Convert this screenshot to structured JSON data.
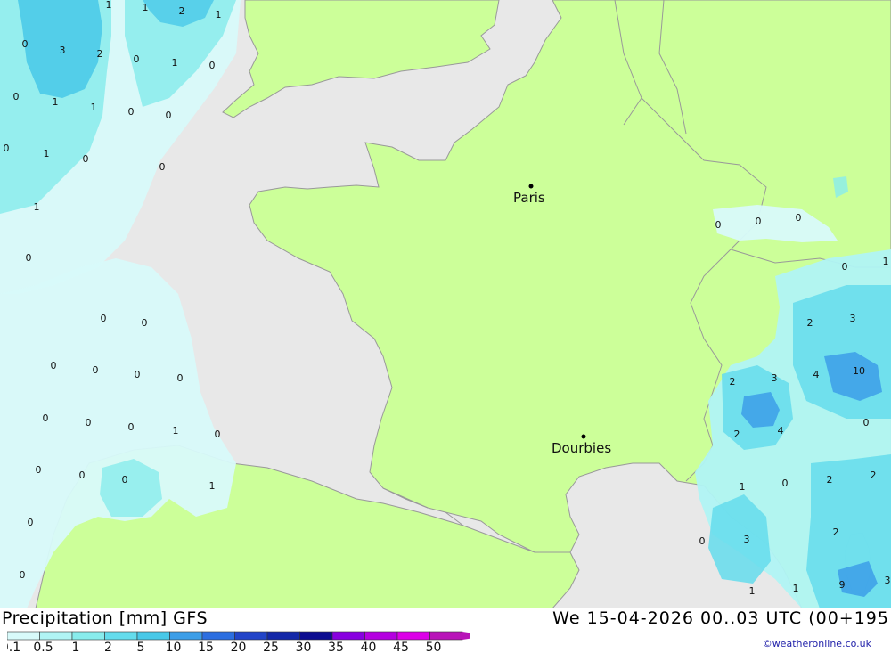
{
  "title": {
    "left": "Precipitation [mm] GFS",
    "right": "We 15-04-2026 00..03 UTC (00+195"
  },
  "credit": "©weatheronline.co.uk",
  "colors": {
    "sea": "#e8e8e8",
    "land": "#ccff99",
    "border": "#999999"
  },
  "legend": {
    "labels": [
      "0.1",
      "0.5",
      "1",
      "2",
      "5",
      "10",
      "15",
      "20",
      "25",
      "30",
      "35",
      "40",
      "45",
      "50"
    ],
    "colors": [
      "#d8fafa",
      "#b0f4f4",
      "#88ecec",
      "#64dcec",
      "#48c8e8",
      "#3c9ee8",
      "#2c6ee0",
      "#2244c8",
      "#1428a8",
      "#0c0c90",
      "#8800e0",
      "#b400e0",
      "#dc00e8",
      "#b814b8"
    ]
  },
  "cities": [
    {
      "name": "Paris"
    },
    {
      "name": "Dourbies"
    }
  ],
  "values": [
    "1",
    "2",
    "1",
    "1",
    "3",
    "2",
    "0",
    "1",
    "0",
    "0",
    "1",
    "1",
    "0",
    "0",
    "0",
    "1",
    "0",
    "0",
    "1",
    "0",
    "0",
    "0",
    "0",
    "0",
    "0",
    "0",
    "0",
    "0",
    "0",
    "1",
    "0",
    "0",
    "0",
    "0",
    "1",
    "0",
    "0",
    "0",
    "0",
    "0",
    "0",
    "0",
    "1",
    "2",
    "3",
    "4",
    "10",
    "2",
    "3",
    "2",
    "4",
    "0",
    "1",
    "0",
    "2",
    "2",
    "3",
    "2",
    "0",
    "1",
    "1",
    "9",
    "3"
  ]
}
